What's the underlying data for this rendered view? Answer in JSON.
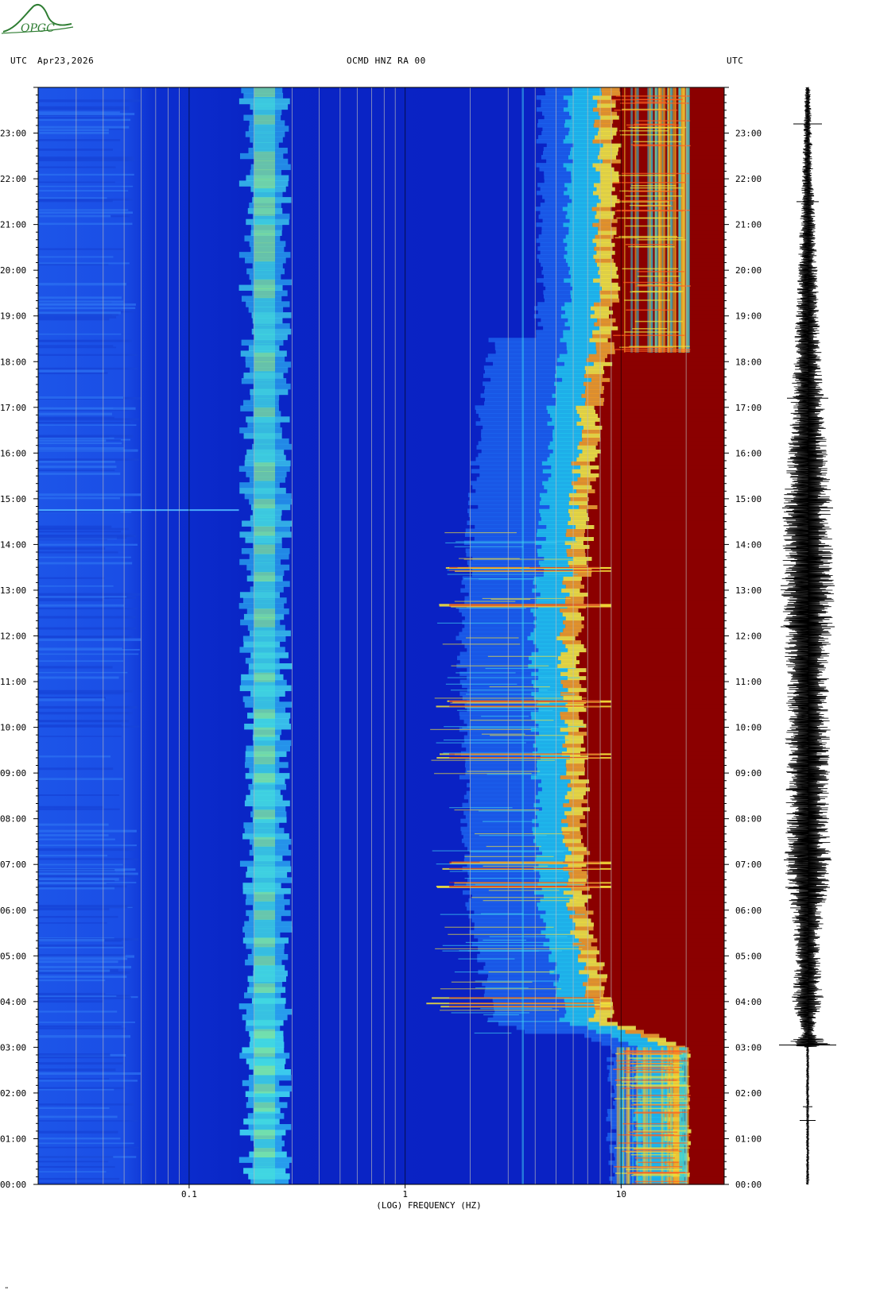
{
  "header": {
    "left_utc": "UTC",
    "date": "Apr23,2026",
    "station": "OCMD HNZ RA 00",
    "right_utc": "UTC"
  },
  "logo": {
    "text": "OPGC",
    "color": "#2e7d32"
  },
  "footer_mark": "\"",
  "colors": {
    "background_blue": "#0a22c8",
    "saturation_red": "#8b0000",
    "waveform": "#000000"
  },
  "chart_data": {
    "type": "heatmap",
    "title": "OCMD HNZ RA 00",
    "xlabel": "(LOG) FREQUENCY (HZ)",
    "x_scale": "log",
    "xlim": [
      0.02,
      30
    ],
    "x_tick_labels": [
      "0.1",
      "1",
      "10"
    ],
    "x_tick_values": [
      0.1,
      1,
      10
    ],
    "ylabel": "UTC",
    "y_tick_labels": [
      "00:00",
      "01:00",
      "02:00",
      "03:00",
      "04:00",
      "05:00",
      "06:00",
      "07:00",
      "08:00",
      "09:00",
      "10:00",
      "11:00",
      "12:00",
      "13:00",
      "14:00",
      "15:00",
      "16:00",
      "17:00",
      "18:00",
      "19:00",
      "20:00",
      "21:00",
      "22:00",
      "23:00"
    ],
    "ylim_hours": [
      0,
      24
    ],
    "colormap": "jet",
    "features": {
      "microseism_band_hz": [
        0.17,
        0.3
      ],
      "saturation_edge_hz": [
        [
          0,
          20
        ],
        [
          3,
          20
        ],
        [
          3.5,
          9
        ],
        [
          6,
          7
        ],
        [
          12,
          6.5
        ],
        [
          17,
          8
        ],
        [
          18.2,
          9
        ],
        [
          20,
          9.5
        ],
        [
          24,
          9.5
        ]
      ],
      "events_hours": [
        4.0,
        6.6,
        7.0,
        9.4,
        10.5,
        12.7,
        13.5
      ],
      "spectral_line_hz": 3.5
    },
    "waveform": {
      "label": "seismogram",
      "envelope_by_hour": [
        [
          0,
          0.05
        ],
        [
          3,
          0.05
        ],
        [
          3.05,
          0.9
        ],
        [
          3.3,
          0.2
        ],
        [
          4,
          0.55
        ],
        [
          5,
          0.45
        ],
        [
          6,
          0.6
        ],
        [
          7,
          0.85
        ],
        [
          8,
          0.75
        ],
        [
          10,
          0.8
        ],
        [
          11,
          0.75
        ],
        [
          13,
          0.95
        ],
        [
          14,
          0.9
        ],
        [
          15,
          0.85
        ],
        [
          16,
          0.7
        ],
        [
          18,
          0.5
        ],
        [
          20,
          0.35
        ],
        [
          22,
          0.2
        ],
        [
          24,
          0.1
        ]
      ]
    }
  }
}
